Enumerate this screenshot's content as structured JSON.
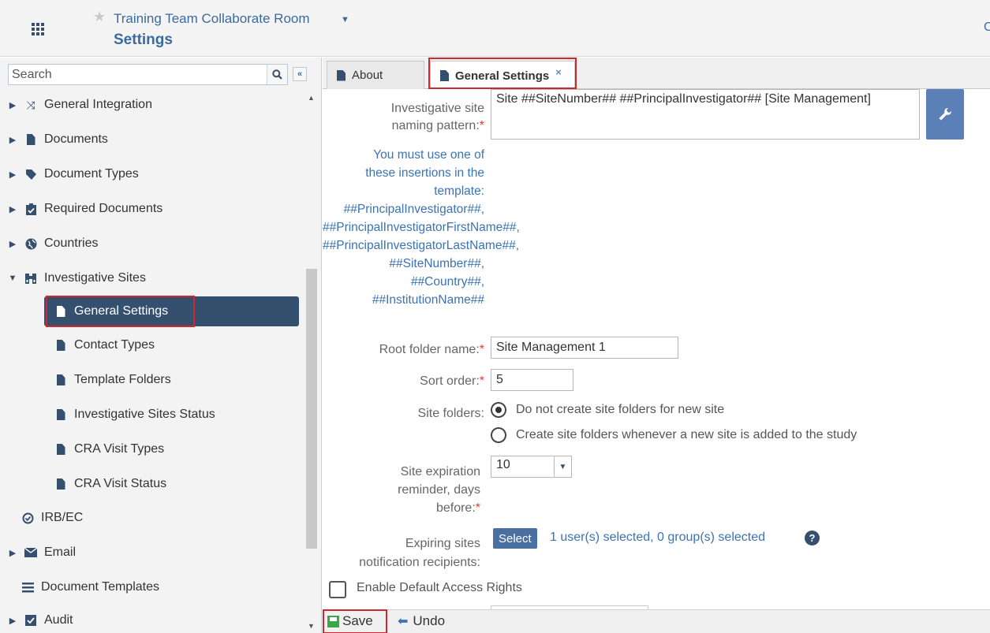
{
  "header": {
    "room_title": "Training Team Collaborate Room",
    "page_title": "Settings"
  },
  "sidebar": {
    "search_placeholder": "Search",
    "items": [
      {
        "label": "General Integration",
        "icon": "shuffle-icon"
      },
      {
        "label": "Documents",
        "icon": "document-icon"
      },
      {
        "label": "Document Types",
        "icon": "tag-icon"
      },
      {
        "label": "Required Documents",
        "icon": "clipboard-check-icon"
      },
      {
        "label": "Countries",
        "icon": "globe-icon"
      },
      {
        "label": "Investigative Sites",
        "icon": "binoculars-icon"
      },
      {
        "label": "General Settings",
        "icon": "document-icon",
        "selected": true
      },
      {
        "label": "Contact Types",
        "icon": "document-icon"
      },
      {
        "label": "Template Folders",
        "icon": "document-icon"
      },
      {
        "label": "Investigative Sites Status",
        "icon": "document-icon"
      },
      {
        "label": "CRA Visit Types",
        "icon": "document-icon"
      },
      {
        "label": "CRA Visit Status",
        "icon": "document-icon"
      },
      {
        "label": "IRB/EC",
        "icon": "check-circle-icon"
      },
      {
        "label": "Email",
        "icon": "envelope-icon"
      },
      {
        "label": "Document Templates",
        "icon": "list-icon"
      },
      {
        "label": "Audit",
        "icon": "audit-icon"
      }
    ]
  },
  "tabs": [
    {
      "label": "About"
    },
    {
      "label": "General Settings",
      "active": true,
      "close": "×"
    }
  ],
  "form": {
    "naming_label_1": "Investigative site",
    "naming_label_2": "naming pattern:",
    "required_mark": "*",
    "naming_value": "Site ##SiteNumber## ##PrincipalInvestigator## [Site Management]",
    "hint_lines": [
      "You must use one of",
      "these insertions in the",
      "template:",
      "##PrincipalInvestigator##,",
      "##PrincipalInvestigatorFirstName##,",
      "##PrincipalInvestigatorLastName##,",
      "##SiteNumber##,",
      "##Country##,",
      "##InstitutionName##"
    ],
    "root_folder_label": "Root folder name:",
    "root_folder_value": "Site Management 1",
    "sort_order_label": "Sort order:",
    "sort_order_value": "5",
    "site_folders_label": "Site folders:",
    "site_folders_option_1": "Do not create site folders for new site",
    "site_folders_option_2": "Create site folders whenever a new site is added to the study",
    "reminder_label_1": "Site expiration",
    "reminder_label_2": "reminder, days",
    "reminder_label_3": "before:",
    "reminder_value": "10",
    "recipients_label_1": "Expiring sites",
    "recipients_label_2": "notification recipients:",
    "select_button": "Select",
    "selected_summary": "1 user(s) selected, 0 group(s) selected",
    "access_rights_label": "Enable Default Access Rights"
  },
  "footer": {
    "save_label": "Save",
    "undo_label": "Undo"
  },
  "colors": {
    "accent": "#35506f",
    "link": "#3b73b3",
    "highlight": "#d0272e",
    "save_green": "#38a84b"
  }
}
